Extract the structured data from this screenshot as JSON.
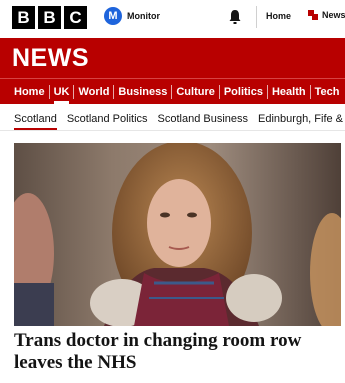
{
  "header": {
    "logo_letters": [
      "B",
      "B",
      "C"
    ],
    "monitor_label": "Monitor",
    "monitor_icon_letter": "M",
    "home_label": "Home",
    "news_label": "News"
  },
  "banner": {
    "title": "NEWS"
  },
  "primary_nav": {
    "items": [
      "Home",
      "UK",
      "World",
      "Business",
      "Culture",
      "Politics",
      "Health",
      "Tech"
    ],
    "active": "UK"
  },
  "secondary_nav": {
    "items": [
      "Scotland",
      "Scotland Politics",
      "Scotland Business",
      "Edinburgh, Fife &"
    ],
    "active": "Scotland"
  },
  "article": {
    "headline": "Trans doctor in changing room row leaves the NHS"
  },
  "colors": {
    "brand_red": "#b80000",
    "monitor_blue": "#1e64dc"
  }
}
